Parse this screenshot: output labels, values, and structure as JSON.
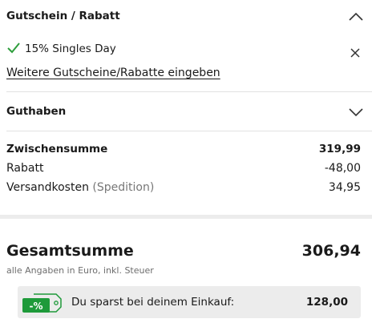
{
  "voucher": {
    "title": "Gutschein / Rabatt",
    "applied": "15% Singles Day",
    "more_link": "Weitere Gutscheine/Rabatte eingeben"
  },
  "credit": {
    "title": "Guthaben"
  },
  "summary": {
    "subtotal_label": "Zwischensumme",
    "subtotal_value": "319,99",
    "discount_label": "Rabatt",
    "discount_value": "-48,00",
    "shipping_label": "Versandkosten",
    "shipping_note": "(Spedition)",
    "shipping_value": "34,95"
  },
  "total": {
    "label": "Gesamtsumme",
    "value": "306,94",
    "note": "alle Angaben in Euro, inkl. Steuer"
  },
  "savings": {
    "badge_text": "-%",
    "text": "Du sparst bei deinem Einkauf:",
    "value": "128,00"
  },
  "icons": {
    "voucher_toggle": "chevron-up-icon",
    "credit_toggle": "chevron-down-icon",
    "applied": "checkmark-icon",
    "remove": "close-icon",
    "badge": "discount-tag-icon"
  },
  "colors": {
    "accent_green": "#2e9e3c",
    "badge_green": "#1e9a3a"
  }
}
